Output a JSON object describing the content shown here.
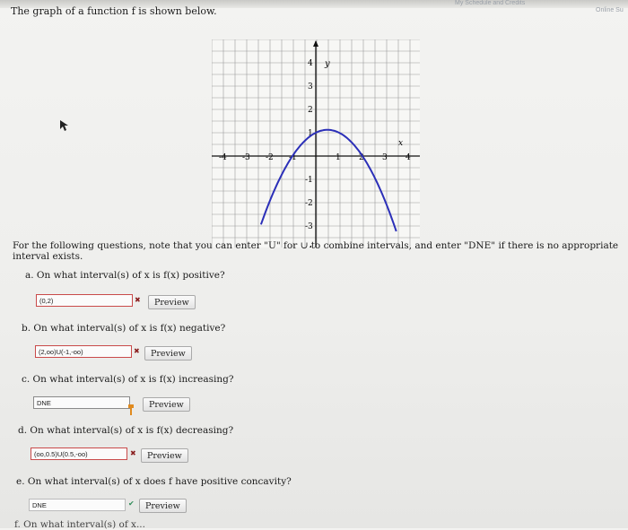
{
  "top": {
    "schedule_link": "My Schedule and Credits",
    "online_link": "Online Su"
  },
  "intro_text": "The graph of a function f is shown below.",
  "graph": {
    "x_ticks": [
      "-4",
      "-3",
      "-2",
      "-1",
      "1",
      "2",
      "3",
      "4"
    ],
    "y_ticks": [
      "4",
      "3",
      "2",
      "1",
      "-1",
      "-2",
      "-3",
      "-4"
    ],
    "x_label": "x",
    "y_label": "y",
    "curve_color": "#2b2fb8"
  },
  "instructions": "For the following questions, note that you can enter \"U\" for ∪ to combine intervals, and enter \"DNE\" if there is no appropriate interval exists.",
  "questions": [
    {
      "label": "a. On what interval(s) of x is f(x) positive?",
      "answer": "(0,2)",
      "status": "wrong",
      "mark": "✖",
      "preview": "Preview"
    },
    {
      "label": "b. On what interval(s) of x is f(x) negative?",
      "answer": "(2,oo)U(-1,-oo)",
      "status": "wrong",
      "mark": "✖",
      "preview": "Preview"
    },
    {
      "label": "c. On what interval(s) of x is f(x) increasing?",
      "answer": "DNE",
      "status": "editing",
      "mark": "",
      "preview": "Preview"
    },
    {
      "label": "d. On what interval(s) of x is f(x) decreasing?",
      "answer": "(oo,0.5)U(0.5,-oo)",
      "status": "wrong",
      "mark": "✖",
      "preview": "Preview"
    },
    {
      "label": "e. On what interval(s) of x does f have positive concavity?",
      "answer": "DNE",
      "status": "correct",
      "mark": "✔",
      "preview": "Preview"
    }
  ],
  "next_question_partial": "f. On what interval(s) of x..."
}
